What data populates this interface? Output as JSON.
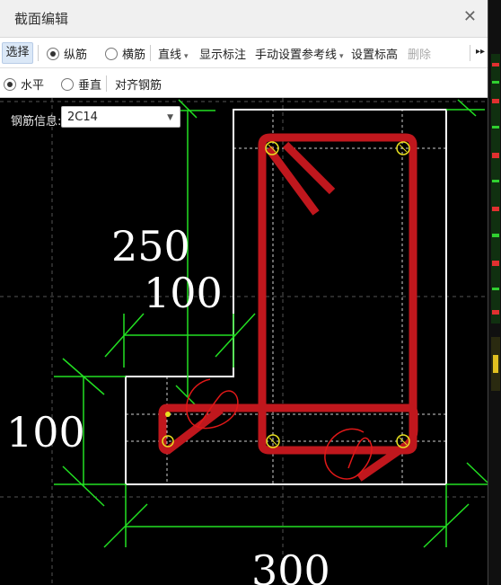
{
  "window": {
    "title": "截面编辑",
    "close_icon": "close-icon"
  },
  "toolbar": {
    "select": "选择",
    "longitudinal": "纵筋",
    "stirrup": "横筋",
    "line": "直线",
    "show_dims": "显示标注",
    "manual_ref": "手动设置参考线",
    "set_elev": "设置标高",
    "delete": "删除",
    "more": "▸▸"
  },
  "toolbar2": {
    "horizontal": "水平",
    "vertical": "垂直",
    "align": "对齐钢筋"
  },
  "rebar": {
    "label": "钢筋信息:",
    "value": "2C14"
  },
  "dimensions": {
    "d250": "250",
    "d100_top": "100",
    "d100_left": "100",
    "d300": "300"
  },
  "colors": {
    "rebar": "#c0171d",
    "dim": "#22e022",
    "outline": "#ffffff",
    "bar": "#e8e020",
    "annotation": "#e01818"
  }
}
